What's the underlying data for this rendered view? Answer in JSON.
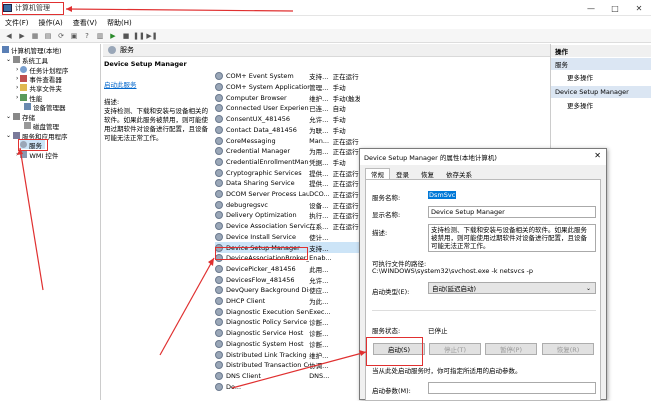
{
  "window": {
    "title": "计算机管理",
    "controls": [
      "—",
      "□",
      "✕"
    ]
  },
  "menu": [
    "文件(F)",
    "操作(A)",
    "查看(V)",
    "帮助(H)"
  ],
  "toolbar": [
    "◀",
    "▶",
    "▦",
    "▤",
    "⟳",
    "▣",
    "?",
    "▥",
    "▶",
    "■",
    "❚❚",
    "▶❚"
  ],
  "tree": {
    "root": "计算机管理(本地)",
    "system_tools": "系统工具",
    "task_scheduler": "任务计划程序",
    "event_viewer": "事件查看器",
    "shared_folders": "共享文件夹",
    "performance": "性能",
    "device_manager": "设备管理器",
    "storage": "存储",
    "disk_management": "磁盘管理",
    "services_apps": "服务和应用程序",
    "services": "服务",
    "wmi": "WMI 控件"
  },
  "center": {
    "header": "服务",
    "selected_name": "Device Setup Manager",
    "link": "启动此服务",
    "desc_label": "描述:",
    "desc_text": "支持检测、下载和安装与设备相关的软件。如果此服务被禁用，则可能使用过期软件对设备进行配置，且设备可能无法正常工作。"
  },
  "services": [
    {
      "name": "COM+ Event System",
      "desc": "支持...",
      "status": "正在运行"
    },
    {
      "name": "COM+ System Application",
      "desc": "管理...",
      "status": "手动"
    },
    {
      "name": "Computer Browser",
      "desc": "维护...",
      "status": "手动(触发"
    },
    {
      "name": "Connected User Experien...",
      "desc": "已连...",
      "status": "自动"
    },
    {
      "name": "ConsentUX_481456",
      "desc": "允许...",
      "status": "手动"
    },
    {
      "name": "Contact Data_481456",
      "desc": "为联...",
      "status": "手动"
    },
    {
      "name": "CoreMessaging",
      "desc": "Man...",
      "status": "正在运行"
    },
    {
      "name": "Credential Manager",
      "desc": "为用...",
      "status": "正在运行"
    },
    {
      "name": "CredentialEnrollmentMana...",
      "desc": "凭据...",
      "status": "手动"
    },
    {
      "name": "Cryptographic Services",
      "desc": "提供...",
      "status": "正在运行"
    },
    {
      "name": "Data Sharing Service",
      "desc": "提供...",
      "status": "正在运行"
    },
    {
      "name": "DCOM Server Process Lau...",
      "desc": "DCO...",
      "status": "正在运行"
    },
    {
      "name": "debugregsvc",
      "desc": "设备...",
      "status": "正在运行"
    },
    {
      "name": "Delivery Optimization",
      "desc": "执行...",
      "status": "正在运行"
    },
    {
      "name": "Device Association Service",
      "desc": "在系...",
      "status": "正在运行"
    },
    {
      "name": "Device Install Service",
      "desc": "使计...",
      "status": ""
    },
    {
      "name": "Device Setup Manager",
      "desc": "支持...",
      "status": ""
    },
    {
      "name": "DeviceAssociationBroker_4...",
      "desc": "Enab...",
      "status": ""
    },
    {
      "name": "DevicePicker_481456",
      "desc": "此用...",
      "status": ""
    },
    {
      "name": "DevicesFlow_481456",
      "desc": "允许...",
      "status": ""
    },
    {
      "name": "DevQuery Background Dis...",
      "desc": "使应...",
      "status": ""
    },
    {
      "name": "DHCP Client",
      "desc": "为此...",
      "status": ""
    },
    {
      "name": "Diagnostic Execution Service",
      "desc": "Exec...",
      "status": ""
    },
    {
      "name": "Diagnostic Policy Service",
      "desc": "诊断...",
      "status": ""
    },
    {
      "name": "Diagnostic Service Host",
      "desc": "诊断...",
      "status": ""
    },
    {
      "name": "Diagnostic System Host",
      "desc": "诊断...",
      "status": ""
    },
    {
      "name": "Distributed Link Tracking ...",
      "desc": "维护...",
      "status": ""
    },
    {
      "name": "Distributed Transaction Co...",
      "desc": "协调...",
      "status": ""
    },
    {
      "name": "DNS Client",
      "desc": "DNS...",
      "status": ""
    },
    {
      "name": "Do...",
      "desc": "",
      "status": ""
    }
  ],
  "actions": {
    "header": "操作",
    "section1": "服务",
    "more1": "更多操作",
    "section2": "Device Setup Manager",
    "more2": "更多操作"
  },
  "dialog": {
    "title": "Device Setup Manager 的属性(本地计算机)",
    "close": "✕",
    "tabs": [
      "常规",
      "登录",
      "恢复",
      "依存关系"
    ],
    "service_name_label": "服务名称:",
    "service_name": "DsmSvc",
    "display_name_label": "显示名称:",
    "display_name": "Device Setup Manager",
    "desc_label": "描述:",
    "desc": "支持检测、下载和安装与设备相关的软件。如果此服务被禁用，则可能使用过期软件对设备进行配置，且设备可能无法正常工作。",
    "path_label": "可执行文件的路径:",
    "path": "C:\\WINDOWS\\system32\\svchost.exe -k netsvcs -p",
    "startup_label": "启动类型(E):",
    "startup_value": "自动(延迟启动)",
    "status_label": "服务状态:",
    "status_value": "已停止",
    "btn_start": "启动(S)",
    "btn_stop": "停止(T)",
    "btn_pause": "暂停(P)",
    "btn_resume": "恢复(R)",
    "hint": "当从此处启动服务时，你可指定所适用的启动参数。",
    "params_label": "启动参数(M):"
  }
}
